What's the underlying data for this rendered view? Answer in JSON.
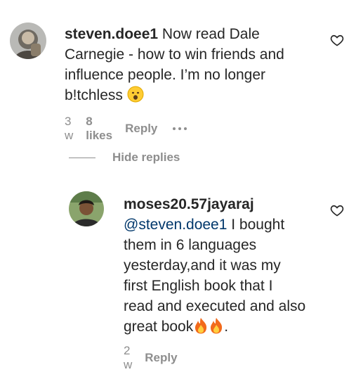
{
  "comment": {
    "username": "steven.doee1",
    "text_part1": " Now read Dale",
    "line2": "Carnegie - how to win friends and",
    "line3": "influence people. I’m no longer",
    "line4": "b!tchless",
    "time": "3 w",
    "likes": "8 likes",
    "reply_label": "Reply",
    "emoji": "hushed-face-emoji"
  },
  "hide_replies_label": "Hide replies",
  "reply": {
    "username": "moses20.57jayaraj",
    "mention": "@steven.doee1",
    "line1_rest": " I bought",
    "line2": "them in 6 languages",
    "line3": "yesterday,and it was my",
    "line4": "first English book that I",
    "line5": "read and executed and also",
    "line6_text": "great book",
    "line6_end": ".",
    "time": "2 w",
    "reply_label": "Reply",
    "emoji": "fire-emoji"
  },
  "colors": {
    "text": "#262626",
    "meta": "#8e8e8e",
    "mention": "#00376b"
  }
}
